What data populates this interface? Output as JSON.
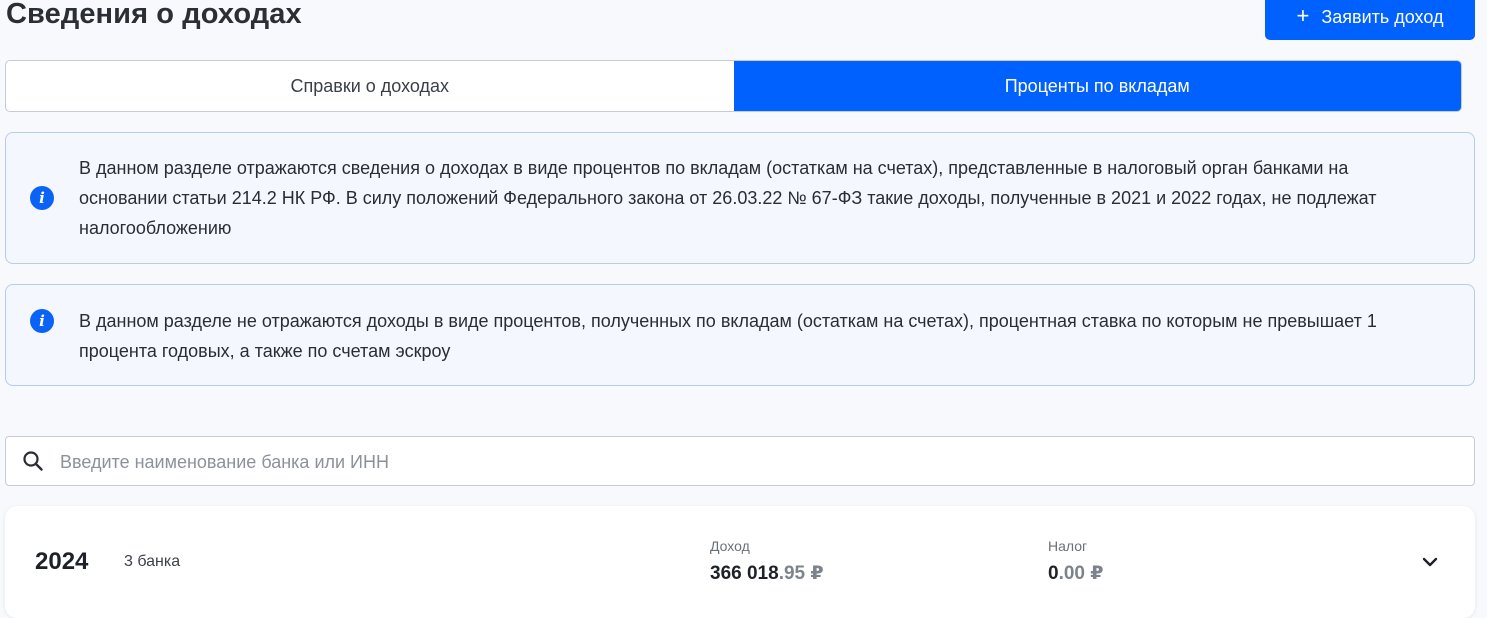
{
  "page": {
    "title": "Сведения о доходах",
    "add_button_label": "Заявить доход",
    "add_button_icon": "plus-icon"
  },
  "tabs": [
    {
      "label": "Справки о доходах",
      "active": false
    },
    {
      "label": "Проценты по вкладам",
      "active": true
    }
  ],
  "info_blocks": [
    {
      "icon": "info-icon",
      "text": "В данном разделе отражаются сведения о доходах в виде процентов по вкладам (остаткам на счетах), представленные в налоговый орган банками на основании статьи 214.2 НК РФ. В силу положений Федерального закона от 26.03.22 № 67-ФЗ такие доходы, полученные в 2021 и 2022 годах, не подлежат налогообложению"
    },
    {
      "icon": "info-icon",
      "text": "В данном разделе не отражаются доходы в виде процентов, полученных по вкладам (остаткам на счетах), процентная ставка по которым не превышает 1 процента годовых, а также по счетам эскроу"
    }
  ],
  "search": {
    "placeholder": "Введите наименование банка или ИНН",
    "value": "",
    "icon": "search-icon"
  },
  "years": [
    {
      "year": "2024",
      "banks": "3 банка",
      "income_label": "Доход",
      "income_int": "366 018",
      "income_dec": ".95 ₽",
      "tax_label": "Налог",
      "tax_int": "0",
      "tax_dec": ".00 ₽",
      "expand_icon": "chevron-down-icon"
    }
  ],
  "colors": {
    "accent": "#0061fe",
    "info_bg": "#f4f7fd",
    "info_border": "#b9cbe6",
    "page_bg": "#f7f9fc"
  }
}
